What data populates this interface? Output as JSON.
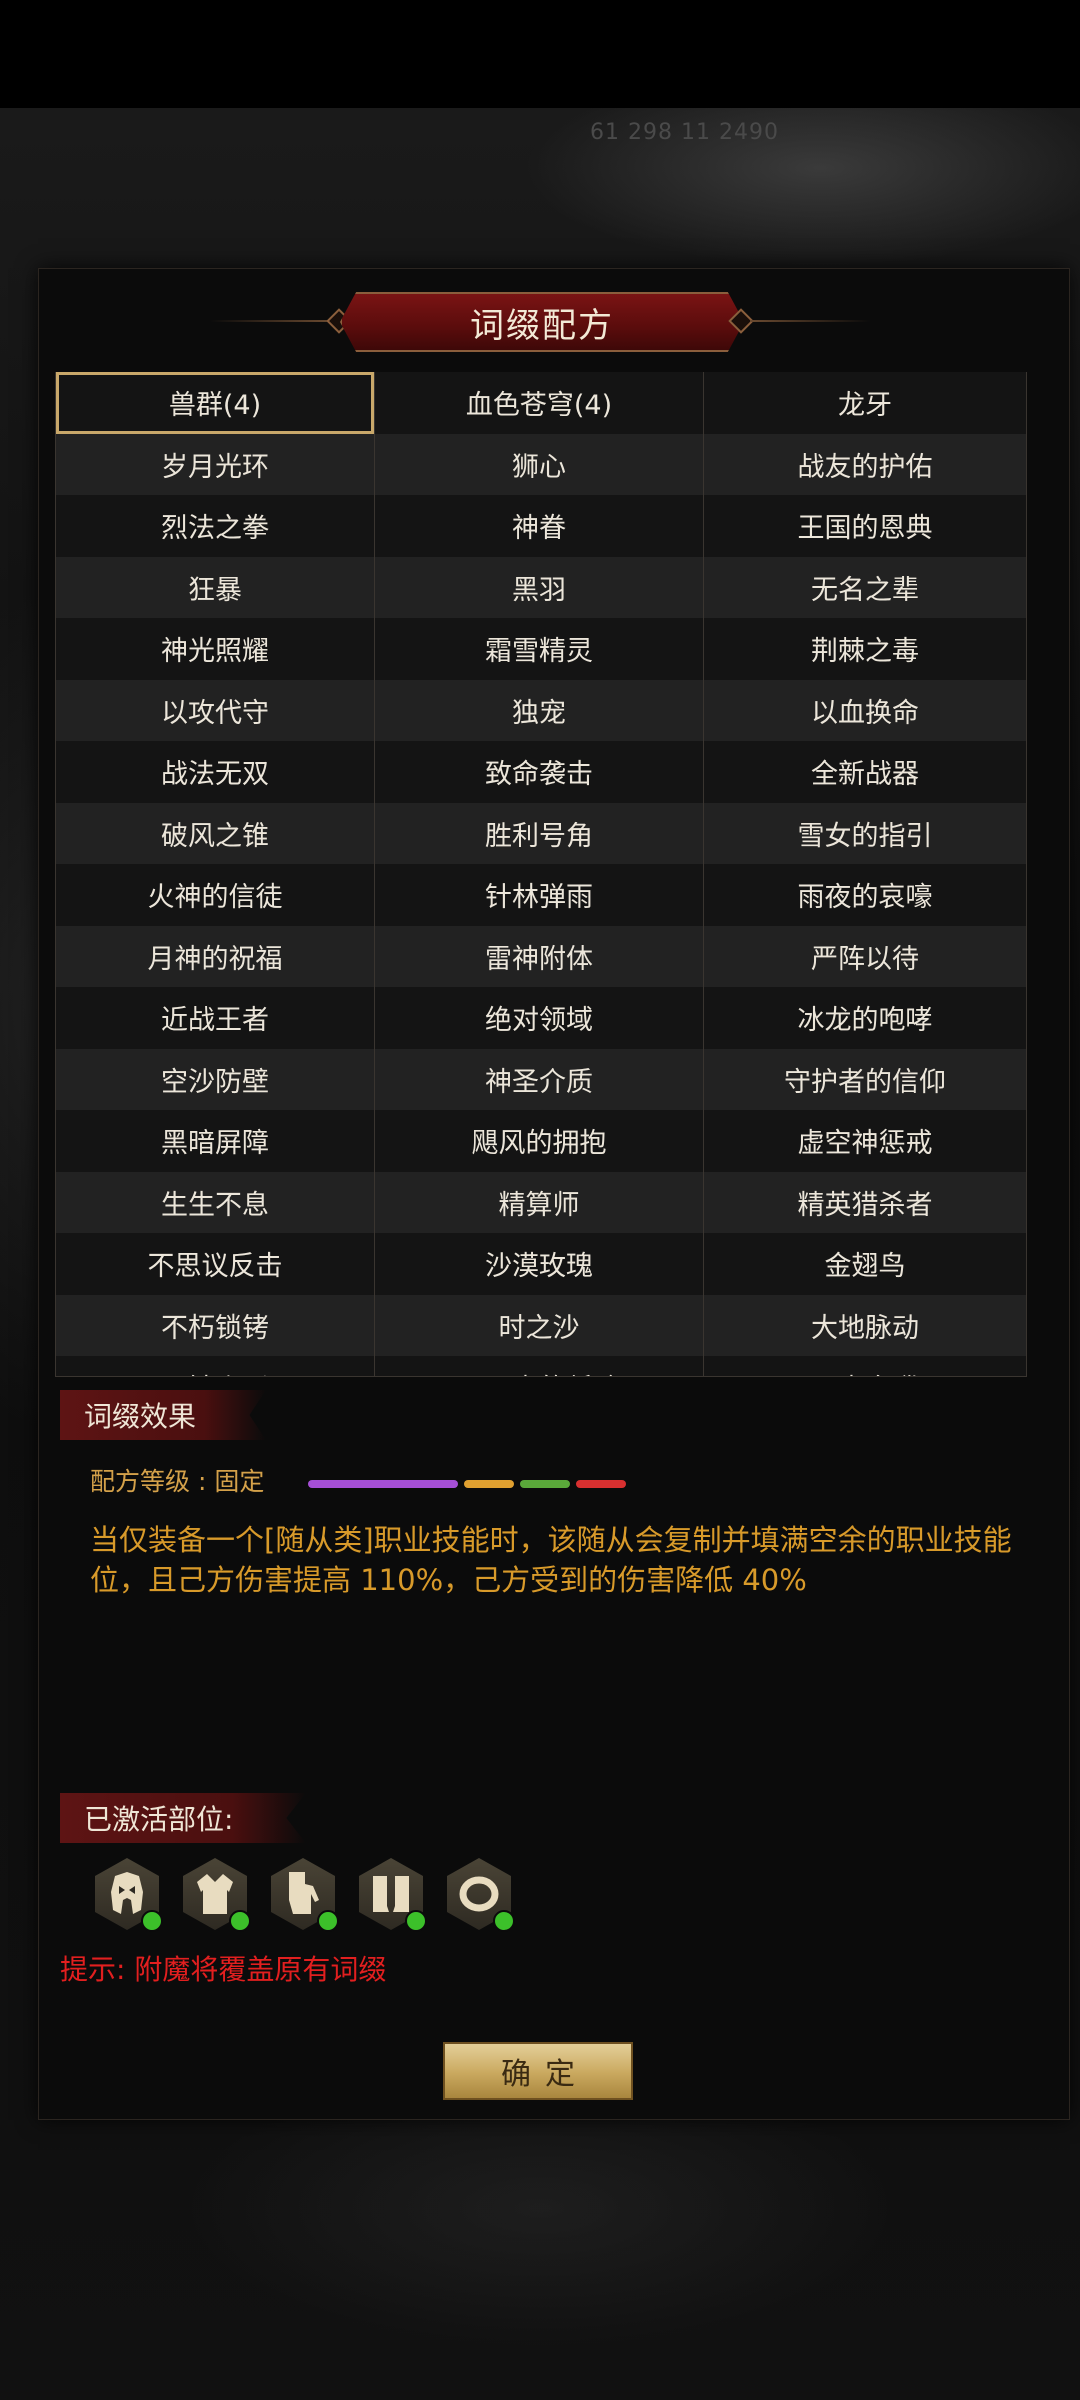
{
  "status_bar": {
    "faint_text": "61 298 11 2490"
  },
  "dialog": {
    "title": "词缀配方"
  },
  "recipes": {
    "rows": [
      [
        "兽群(4)",
        "血色苍穹(4)",
        "龙牙"
      ],
      [
        "岁月光环",
        "狮心",
        "战友的护佑"
      ],
      [
        "烈法之拳",
        "神眷",
        "王国的恩典"
      ],
      [
        "狂暴",
        "黑羽",
        "无名之辈"
      ],
      [
        "神光照耀",
        "霜雪精灵",
        "荆棘之毒"
      ],
      [
        "以攻代守",
        "独宠",
        "以血换命"
      ],
      [
        "战法无双",
        "致命袭击",
        "全新战器"
      ],
      [
        "破风之锥",
        "胜利号角",
        "雪女的指引"
      ],
      [
        "火神的信徒",
        "针林弹雨",
        "雨夜的哀嚎"
      ],
      [
        "月神的祝福",
        "雷神附体",
        "严阵以待"
      ],
      [
        "近战王者",
        "绝对领域",
        "冰龙的咆哮"
      ],
      [
        "空沙防壁",
        "神圣介质",
        "守护者的信仰"
      ],
      [
        "黑暗屏障",
        "飓风的拥抱",
        "虚空神惩戒"
      ],
      [
        "生生不息",
        "精算师",
        "精英猎杀者"
      ],
      [
        "不思议反击",
        "沙漠玫瑰",
        "金翅鸟"
      ],
      [
        "不朽锁铐",
        "时之沙",
        "大地脉动"
      ],
      [
        "风蚀幽影",
        "四元素的低吟",
        "元素奔腾"
      ]
    ],
    "selected": "兽群(4)"
  },
  "effects": {
    "section_label": "词缀效果",
    "level_label": "配方等级 : 固定",
    "level_bar_colors": [
      "#a64fd6",
      "#e0a030",
      "#5aa83a",
      "#d83030"
    ],
    "description": "当仅装备一个[随从类]职业技能时，该随从会复制并填满空余的职业技能位，且己方伤害提高 110%，己方受到的伤害降低 40%"
  },
  "activated": {
    "section_label": "已激活部位:",
    "parts": [
      {
        "icon": "helmet-icon"
      },
      {
        "icon": "armor-icon"
      },
      {
        "icon": "gloves-icon"
      },
      {
        "icon": "boots-icon"
      },
      {
        "icon": "ring-icon"
      }
    ],
    "active_color": "#3cc02a"
  },
  "hint": "提示: 附魔将覆盖原有词缀",
  "confirm_label": "确定"
}
